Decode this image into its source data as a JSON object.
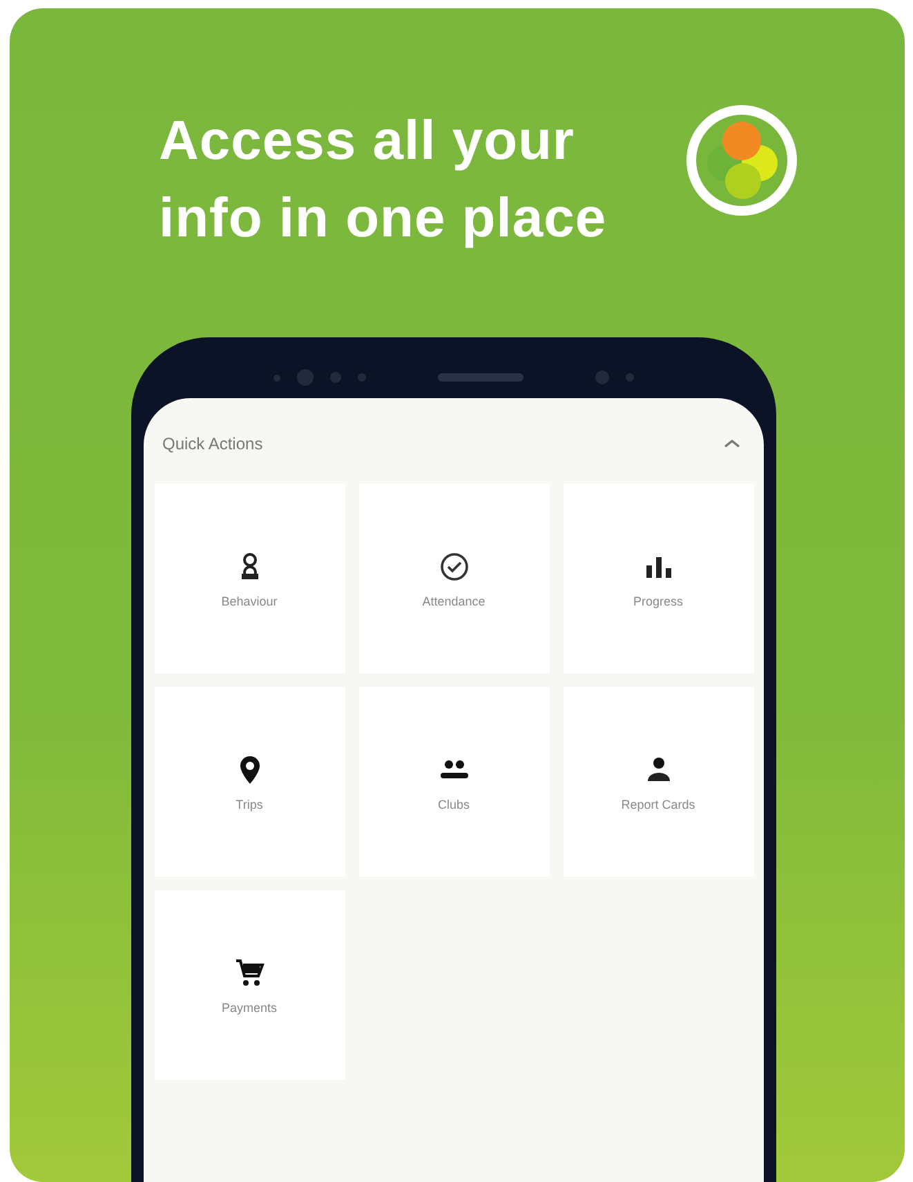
{
  "headline": "Access all your info in one place",
  "screen": {
    "section_title": "Quick Actions",
    "expanded": true,
    "actions": [
      {
        "kind": "behaviour",
        "label": "Behaviour"
      },
      {
        "kind": "attendance",
        "label": "Attendance"
      },
      {
        "kind": "progress",
        "label": "Progress"
      },
      {
        "kind": "trips",
        "label": "Trips"
      },
      {
        "kind": "clubs",
        "label": "Clubs"
      },
      {
        "kind": "reportcards",
        "label": "Report Cards"
      },
      {
        "kind": "payments",
        "label": "Payments"
      }
    ]
  }
}
